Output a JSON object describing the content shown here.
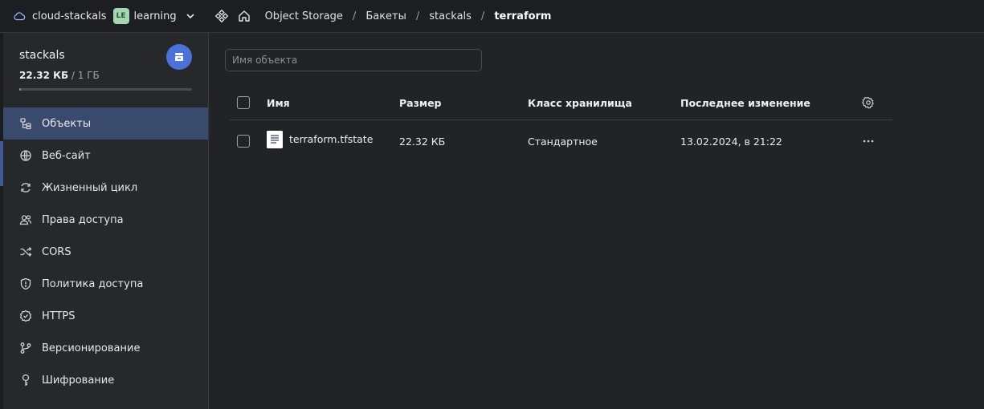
{
  "topbar": {
    "cloud_name": "cloud-stackals",
    "folder_badge": "LE",
    "folder_name": "learning",
    "breadcrumbs": [
      "Object Storage",
      "Бакеты",
      "stackals",
      "terraform"
    ]
  },
  "sidebar": {
    "bucket_name": "stackals",
    "size_used": "22.32 КБ",
    "size_total": "/ 1 ГБ",
    "usage_fraction": 0.01,
    "items": [
      {
        "label": "Объекты",
        "icon": "objects-icon",
        "active": true
      },
      {
        "label": "Веб-сайт",
        "icon": "globe-icon"
      },
      {
        "label": "Жизненный цикл",
        "icon": "lifecycle-icon"
      },
      {
        "label": "Права доступа",
        "icon": "users-icon"
      },
      {
        "label": "CORS",
        "icon": "shuffle-icon"
      },
      {
        "label": "Политика доступа",
        "icon": "shield-icon"
      },
      {
        "label": "HTTPS",
        "icon": "badge-check-icon"
      },
      {
        "label": "Версионирование",
        "icon": "branch-icon"
      },
      {
        "label": "Шифрование",
        "icon": "key-icon"
      }
    ]
  },
  "main": {
    "search_placeholder": "Имя объекта",
    "columns": {
      "name": "Имя",
      "size": "Размер",
      "class": "Класс хранилища",
      "modified": "Последнее изменение"
    },
    "rows": [
      {
        "name": "terraform.tfstate",
        "size": "22.32 КБ",
        "class": "Стандартное",
        "modified": "13.02.2024, в 21:22"
      }
    ]
  },
  "colors": {
    "accent": "#4a72d8",
    "active_nav": "#3a4a6c",
    "usage": "#4fc46a",
    "folder_badge_bg": "#a5d6b0"
  }
}
